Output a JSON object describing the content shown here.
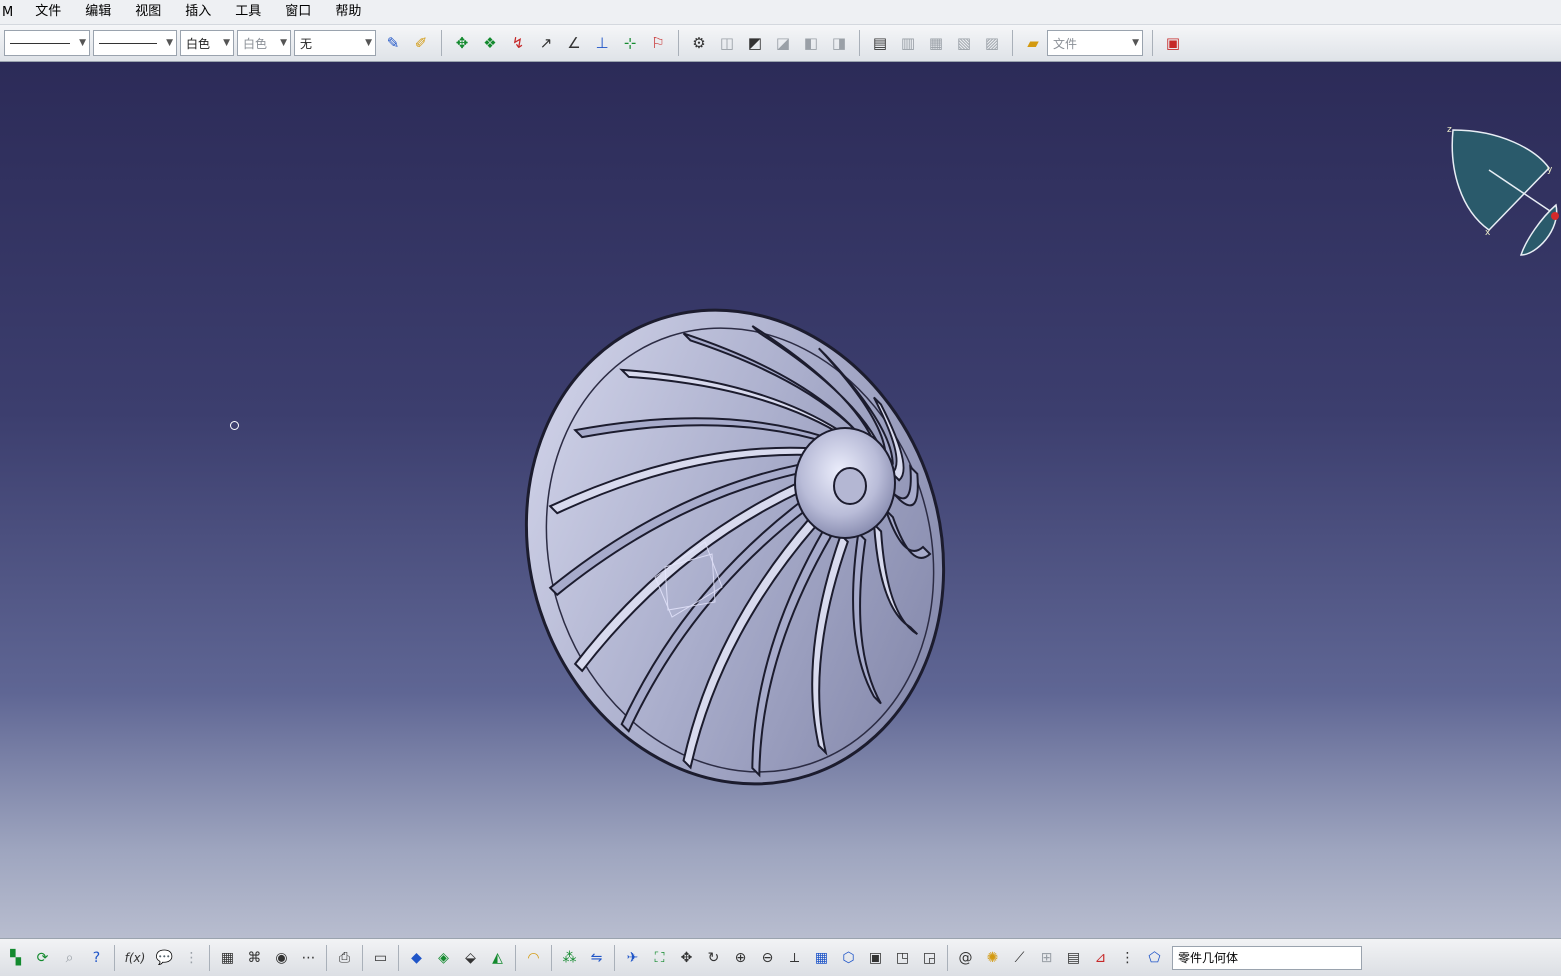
{
  "menubar": {
    "app": "M",
    "items": [
      "文件",
      "编辑",
      "视图",
      "插入",
      "工具",
      "窗口",
      "帮助"
    ]
  },
  "toolbar": {
    "linetype_value": "",
    "lineweight_value": "",
    "color_value": "白色",
    "layer_color_value": "白色",
    "layer_value": "无",
    "file_label": "文件"
  },
  "viewport": {
    "background_top": "#2c2b58",
    "background_bottom": "#b8bdcf",
    "model_color": "#b9bcd8",
    "compass_color": "#2a5a6b"
  },
  "compass": {
    "axis_x": "x",
    "axis_y": "y",
    "axis_z": "z"
  },
  "bottombar": {
    "fx_label": "f(x)",
    "body_selector": "零件几何体"
  }
}
